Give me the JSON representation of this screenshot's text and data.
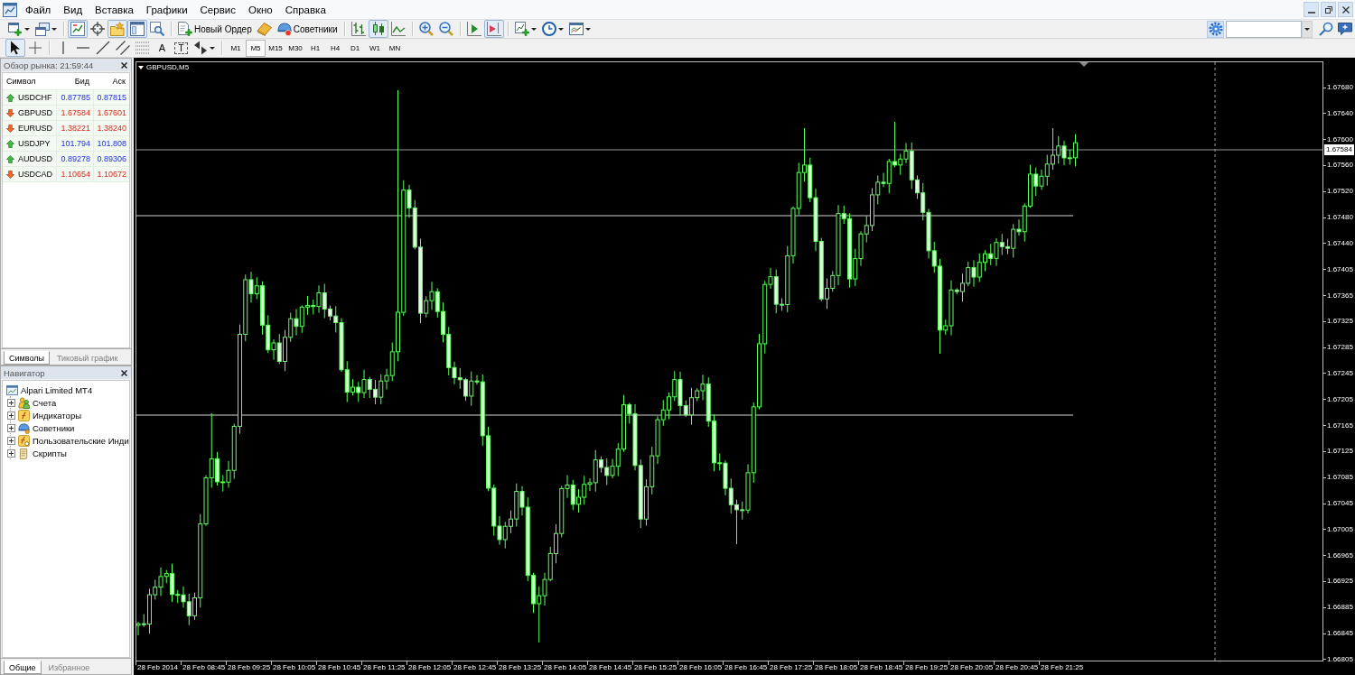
{
  "menu_bar": {
    "items": [
      "Файл",
      "Вид",
      "Вставка",
      "Графики",
      "Сервис",
      "Окно",
      "Справка"
    ]
  },
  "toolbar": {
    "groups": [
      [
        {
          "kind": "new-chart",
          "dropdown": true,
          "pressed": false
        },
        {
          "kind": "profiles",
          "dropdown": true,
          "pressed": false
        }
      ],
      [
        {
          "kind": "market-watch",
          "dropdown": false,
          "pressed": true
        },
        {
          "kind": "data-window",
          "dropdown": false,
          "pressed": false
        },
        {
          "kind": "navigator",
          "dropdown": false,
          "pressed": true
        },
        {
          "kind": "terminal",
          "dropdown": false,
          "pressed": true
        },
        {
          "kind": "tester",
          "dropdown": false,
          "pressed": false
        }
      ],
      [
        {
          "kind": "new-order",
          "label": "Новый Ордер",
          "dropdown": false,
          "pressed": false
        },
        {
          "kind": "editor",
          "dropdown": false,
          "pressed": false
        },
        {
          "kind": "experts",
          "label": "Советники",
          "dropdown": false,
          "pressed": false
        }
      ],
      [
        {
          "kind": "bar-chart",
          "dropdown": false,
          "pressed": false
        },
        {
          "kind": "candle-chart",
          "dropdown": false,
          "pressed": true
        },
        {
          "kind": "line-chart",
          "dropdown": false,
          "pressed": false
        }
      ],
      [
        {
          "kind": "zoom-in",
          "dropdown": false,
          "pressed": false
        },
        {
          "kind": "zoom-out",
          "dropdown": false,
          "pressed": false
        }
      ],
      [
        {
          "kind": "autoscroll",
          "dropdown": false,
          "pressed": false
        },
        {
          "kind": "chart-shift",
          "dropdown": false,
          "pressed": true
        }
      ],
      [
        {
          "kind": "indicators",
          "dropdown": true,
          "pressed": false
        },
        {
          "kind": "periods",
          "dropdown": true,
          "pressed": false
        },
        {
          "kind": "templates",
          "dropdown": true,
          "pressed": false
        }
      ]
    ]
  },
  "drawing_toolbar": {
    "groups": [
      [
        {
          "kind": "cursor",
          "dropdown": false,
          "pressed": true
        },
        {
          "kind": "crosshair",
          "dropdown": false,
          "pressed": false
        }
      ],
      [
        {
          "kind": "vertical-line",
          "dropdown": false,
          "pressed": false
        },
        {
          "kind": "horizontal-line",
          "dropdown": false,
          "pressed": false
        },
        {
          "kind": "trend-line",
          "dropdown": false,
          "pressed": false
        },
        {
          "kind": "channel",
          "dropdown": false,
          "pressed": false
        },
        {
          "kind": "fibonacci",
          "dropdown": false,
          "pressed": false
        },
        {
          "kind": "text",
          "label": "A",
          "dropdown": false,
          "pressed": false
        },
        {
          "kind": "text-label",
          "label": "T",
          "dropdown": false,
          "pressed": false
        },
        {
          "kind": "arrows",
          "dropdown": true,
          "pressed": false
        }
      ]
    ]
  },
  "timeframes": [
    {
      "label": "M1",
      "selected": false
    },
    {
      "label": "M5",
      "selected": true
    },
    {
      "label": "M15",
      "selected": false
    },
    {
      "label": "M30",
      "selected": false
    },
    {
      "label": "H1",
      "selected": false
    },
    {
      "label": "H4",
      "selected": false
    },
    {
      "label": "D1",
      "selected": false
    },
    {
      "label": "W1",
      "selected": false
    },
    {
      "label": "MN",
      "selected": false
    }
  ],
  "market_watch": {
    "title": "Обзор рынка: 21:59:44",
    "columns": [
      "Символ",
      "Бид",
      "Аск"
    ],
    "rows": [
      {
        "symbol": "USDCHF",
        "bid": "0.87785",
        "ask": "0.87815",
        "kind": "up"
      },
      {
        "symbol": "GBPUSD",
        "bid": "1.67584",
        "ask": "1.67601",
        "kind": "down"
      },
      {
        "symbol": "EURUSD",
        "bid": "1.38221",
        "ask": "1.38240",
        "kind": "down"
      },
      {
        "symbol": "USDJPY",
        "bid": "101.794",
        "ask": "101.808",
        "kind": "up"
      },
      {
        "symbol": "AUDUSD",
        "bid": "0.89278",
        "ask": "0.89306",
        "kind": "up"
      },
      {
        "symbol": "USDCAD",
        "bid": "1.10654",
        "ask": "1.10672",
        "kind": "down"
      }
    ],
    "tabs": [
      {
        "label": "Символы",
        "selected": true
      },
      {
        "label": "Тиковый график",
        "selected": false
      }
    ]
  },
  "navigator": {
    "title": "Навигатор",
    "tree": [
      {
        "label": "Alpari Limited MT4",
        "kind": "terminal",
        "children": [
          {
            "label": "Счета",
            "kind": "accounts",
            "expanded": false
          },
          {
            "label": "Индикаторы",
            "kind": "indicators",
            "expanded": false
          },
          {
            "label": "Советники",
            "kind": "experts",
            "expanded": false
          },
          {
            "label": "Пользовательские Инди",
            "kind": "custom-indicators",
            "expanded": false
          },
          {
            "label": "Скрипты",
            "kind": "scripts",
            "expanded": false
          }
        ]
      }
    ],
    "tabs": [
      {
        "label": "Общие",
        "selected": true
      },
      {
        "label": "Избранное",
        "selected": false
      }
    ]
  },
  "chart": {
    "title": "GBPUSD,M5",
    "current_price": "1.67584",
    "price_axis": [
      "1.67680",
      "1.67640",
      "1.67600",
      "1.67560",
      "1.67520",
      "1.67480",
      "1.67440",
      "1.67405",
      "1.67365",
      "1.67325",
      "1.67285",
      "1.67245",
      "1.67205",
      "1.67165",
      "1.67125",
      "1.67085",
      "1.67045",
      "1.67005",
      "1.66965",
      "1.66925",
      "1.66885",
      "1.66845",
      "1.66805"
    ],
    "time_axis": [
      "28 Feb 2014",
      "28 Feb 08:45",
      "28 Feb 09:25",
      "28 Feb 10:05",
      "28 Feb 10:45",
      "28 Feb 11:25",
      "28 Feb 12:05",
      "28 Feb 12:45",
      "28 Feb 13:25",
      "28 Feb 14:05",
      "28 Feb 14:45",
      "28 Feb 15:25",
      "28 Feb 16:05",
      "28 Feb 16:45",
      "28 Feb 17:25",
      "28 Feb 18:05",
      "28 Feb 18:45",
      "28 Feb 19:25",
      "28 Feb 20:05",
      "28 Feb 20:45",
      "28 Feb 21:25"
    ]
  }
}
